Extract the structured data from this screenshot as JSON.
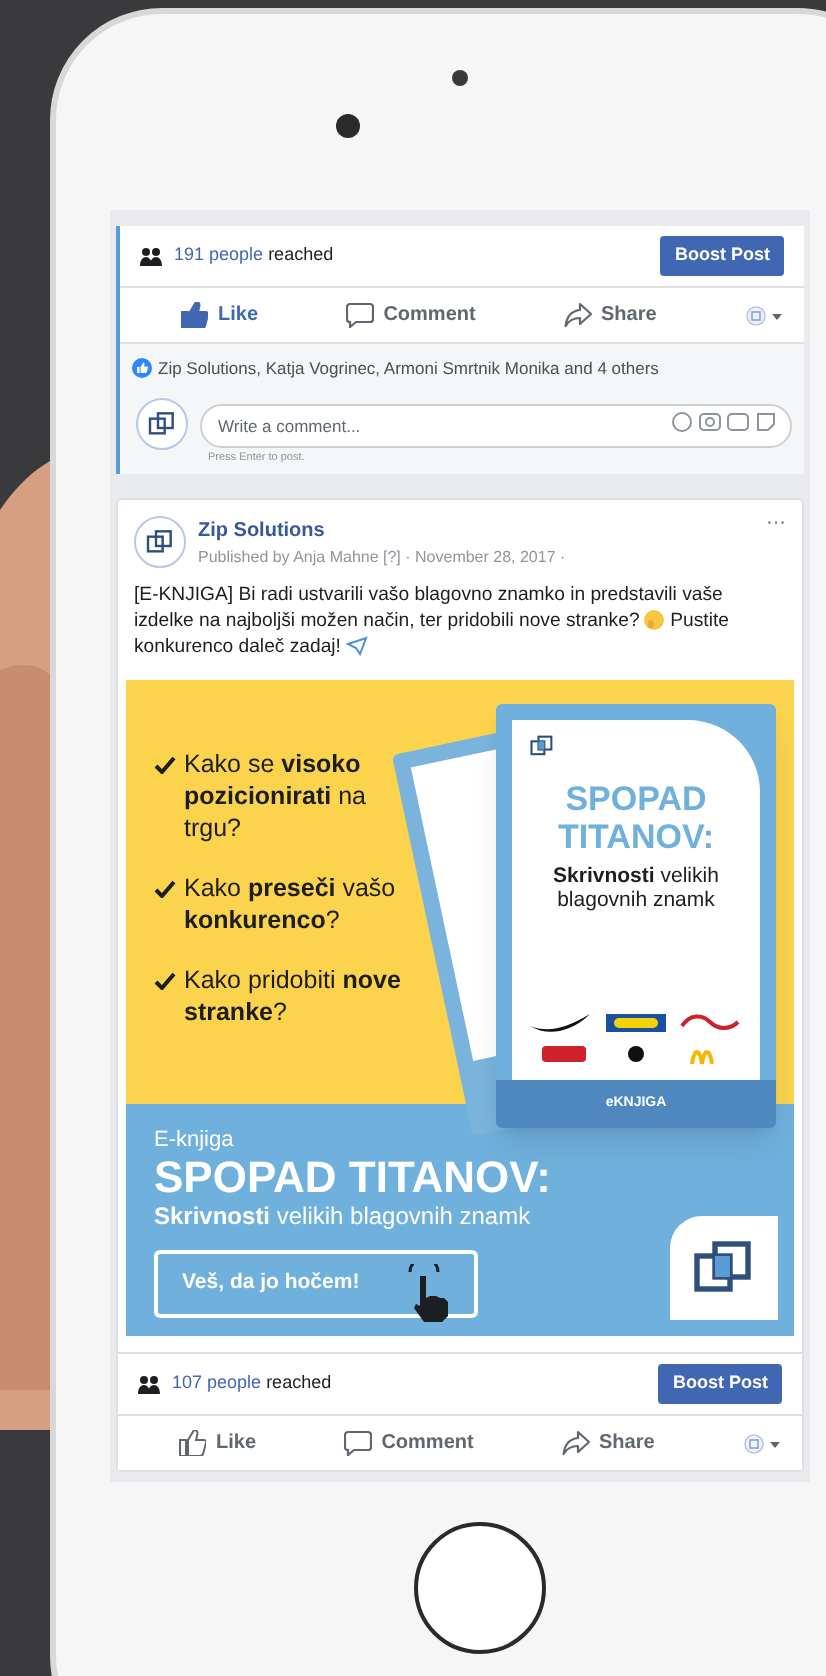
{
  "previous_post": {
    "reach": {
      "count": "191 people",
      "suffix": "reached"
    },
    "boost": "Boost Post",
    "liked": true,
    "actions": [
      {
        "kind": "like",
        "label": "Like"
      },
      {
        "kind": "comment",
        "label": "Comment"
      },
      {
        "kind": "share",
        "label": "Share"
      }
    ],
    "likes": "Zip Solutions, Katja Vogrinec, Armoni Smrtnik Monika and 4 others",
    "comment": {
      "placeholder": "Write a comment...",
      "hint": "Press Enter to post."
    }
  },
  "post": {
    "page": "Zip Solutions",
    "published": "Published by Anja Mahne [?] · November 28, 2017 ·",
    "text_parts": [
      "[E-KNJIGA] Bi radi ustvarili vašo blagovno znamko in predstavili vaše izdelke na najboljši možen način, ter pridobili nove stranke?",
      "Pustite konkurenco daleč zadaj!"
    ],
    "more": "···",
    "ad": {
      "bullets": [
        "Kako se **visoko pozicionirati** na trgu?",
        "Kako **preseči** vašo **konkurenco**?",
        "Kako pridobiti **nove stranke**?"
      ],
      "book": {
        "title": "SPOPAD TITANOV:",
        "subtitle": "**Skrivnosti** velikih blagovnih znamk",
        "footer": "eKNJIGA"
      },
      "kicker": "E-knjiga",
      "title": "SPOPAD TITANOV:",
      "subtitle": "**Skrivnosti** velikih blagovnih znamk",
      "button": "Veš, da jo hočem!"
    },
    "reach": {
      "count": "107 people",
      "suffix": "reached"
    },
    "boost": "Boost Post",
    "liked": false,
    "actions": [
      {
        "kind": "like",
        "label": "Like"
      },
      {
        "kind": "comment",
        "label": "Comment"
      },
      {
        "kind": "share",
        "label": "Share"
      }
    ]
  }
}
